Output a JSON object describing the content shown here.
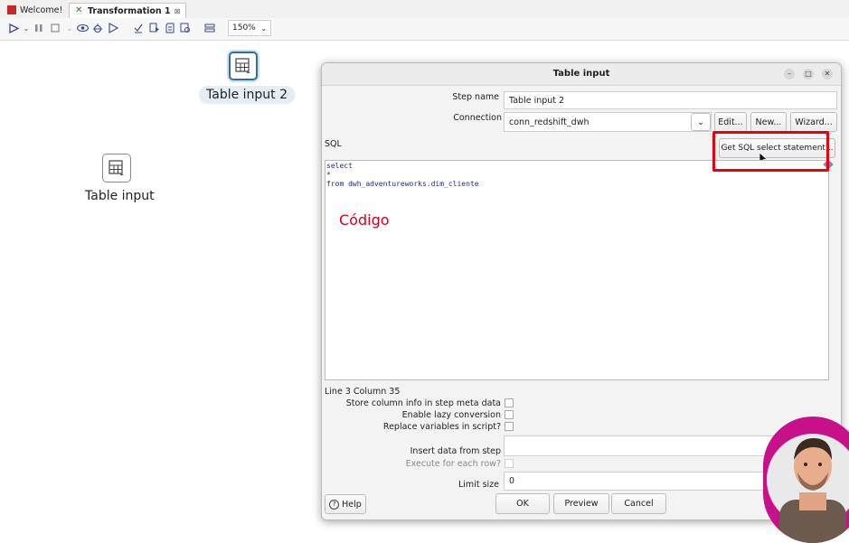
{
  "tabs": [
    {
      "label": "Welcome!"
    },
    {
      "label": "Transformation 1",
      "close": "⊠"
    }
  ],
  "toolbar": {
    "zoom": "150%"
  },
  "canvas": {
    "steps": [
      {
        "label": "Table input 2"
      },
      {
        "label": "Table input"
      }
    ]
  },
  "dialog": {
    "title": "Table input",
    "step_name_label": "Step name",
    "step_name_value": "Table input 2",
    "connection_label": "Connection",
    "connection_value": "conn_redshift_dwh",
    "edit_button": "Edit...",
    "new_button": "New...",
    "wizard_button": "Wizard...",
    "sql_label": "SQL",
    "get_sql_button": "Get SQL select statement...",
    "sql_lines": [
      "select",
      "*",
      "from dwh_adventureworks.dim_cliente"
    ],
    "annotation": "Código",
    "cursor_position": "Line 3 Column 35",
    "store_column_info_label": "Store column info in step meta data",
    "enable_lazy_label": "Enable lazy conversion",
    "replace_variables_label": "Replace variables in script?",
    "insert_data_label": "Insert data from step",
    "execute_each_row_label": "Execute for each row?",
    "limit_size_label": "Limit size",
    "limit_size_value": "0",
    "help_button": "Help",
    "ok_button": "OK",
    "preview_button": "Preview",
    "cancel_button": "Cancel"
  },
  "colors": {
    "accent": "#2f6fa8",
    "highlight": "#e8000f",
    "annotation": "#d0021b",
    "webcam_ring": "#c8108a"
  }
}
